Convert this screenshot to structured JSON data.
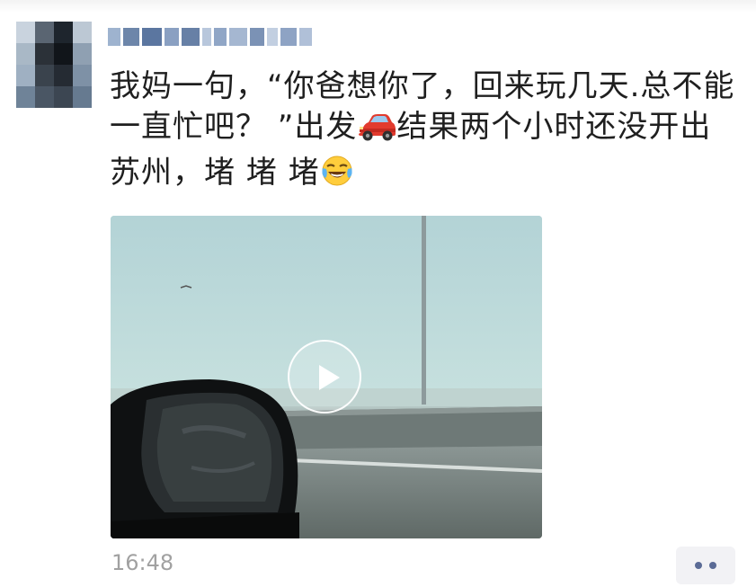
{
  "post": {
    "line1": "我妈一句，“你爸想你了，回来玩几天.总不能",
    "line2_a": "一直忙吧？ ”出发",
    "line2_b": "结果两个小时还没开出",
    "line3": "苏州，堵 堵 堵",
    "emoji_car": "car-emoji",
    "emoji_face": "laughing-crying-emoji"
  },
  "video": {
    "play_icon": "play-icon"
  },
  "meta": {
    "timestamp": "16:48",
    "more_icon": "more-dots-icon"
  },
  "colors": {
    "text": "#1f1f1f",
    "timestamp": "#a1a1a1",
    "more_dots": "#5b6b96",
    "more_bg": "#f2f2f5"
  }
}
